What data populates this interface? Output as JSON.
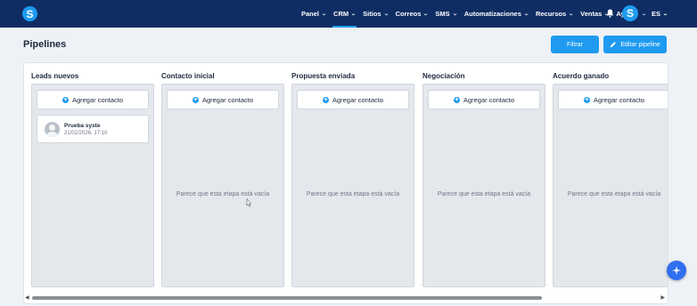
{
  "nav": {
    "logo": "S",
    "items": [
      {
        "label": "Panel",
        "chevron": true
      },
      {
        "label": "CRM",
        "chevron": true,
        "active": true
      },
      {
        "label": "Sitios",
        "chevron": true
      },
      {
        "label": "Correos",
        "chevron": true
      },
      {
        "label": "SMS",
        "chevron": true
      },
      {
        "label": "Automatizaciones",
        "chevron": true
      },
      {
        "label": "Recursos",
        "chevron": true
      },
      {
        "label": "Ventas",
        "chevron": true
      },
      {
        "label": "Ayuda",
        "chevron": false
      }
    ],
    "avatar": "S",
    "language": "ES",
    "icons": {
      "bell": "bell-icon"
    }
  },
  "header": {
    "title": "Pipelines",
    "filter_label": "Filtrar",
    "edit_label": "Editar pipeline"
  },
  "board": {
    "add_label": "Agregar contacto",
    "empty_text": "Parece que esta etapa está vacía",
    "columns": [
      {
        "title": "Leads nuevos"
      },
      {
        "title": "Contacto inicial"
      },
      {
        "title": "Propuesta enviada"
      },
      {
        "title": "Negociación"
      },
      {
        "title": "Acuerdo ganado"
      }
    ],
    "card": {
      "name": "Prueba syste",
      "date": "21/02/2026, 17:10"
    }
  },
  "colors": {
    "nav_bg": "#0f2d63",
    "accent": "#1e9bf0",
    "fab": "#2f6ff0"
  }
}
